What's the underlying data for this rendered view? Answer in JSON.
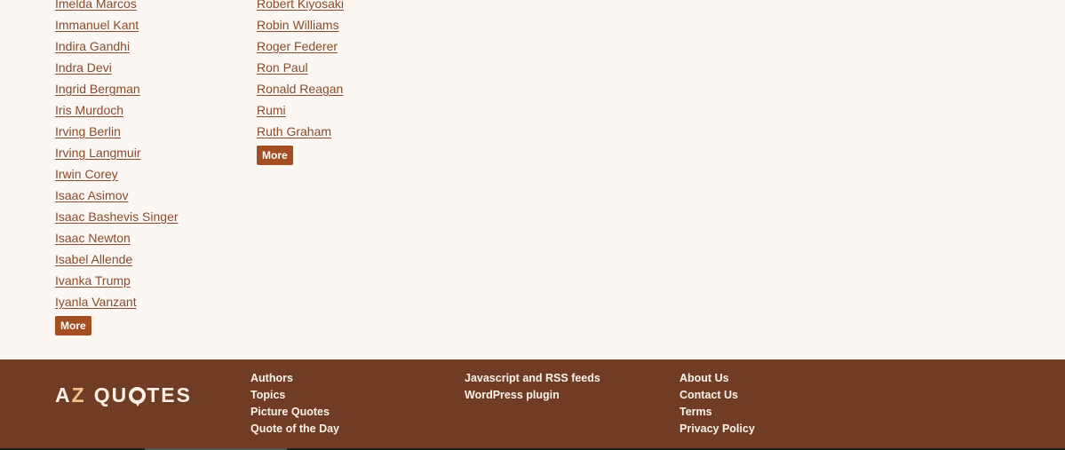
{
  "authors": {
    "column_a": [
      "Imelda Marcos",
      "Immanuel Kant",
      "Indira Gandhi",
      "Indra Devi",
      "Ingrid Bergman",
      "Iris Murdoch",
      "Irving Berlin",
      "Irving Langmuir",
      "Irwin Corey",
      "Isaac Asimov",
      "Isaac Bashevis Singer",
      "Isaac Newton",
      "Isabel Allende",
      "Ivanka Trump",
      "Iyanla Vanzant"
    ],
    "column_b": [
      "Robert Kiyosaki",
      "Robin Williams",
      "Roger Federer",
      "Ron Paul",
      "Ronald Reagan",
      "Rumi",
      "Ruth Graham"
    ],
    "more_label": "More"
  },
  "footer": {
    "logo": {
      "part1": "A",
      "part2": "Z",
      "part3": "QU",
      "part4": "TES"
    },
    "links_col1": [
      "Authors",
      "Topics",
      "Picture Quotes",
      "Quote of the Day"
    ],
    "links_col2": [
      "Javascript and RSS feeds",
      "WordPress plugin"
    ],
    "links_col3": [
      "About Us",
      "Contact Us",
      "Terms",
      "Privacy Policy"
    ]
  },
  "colors": {
    "background": "#fcf7f2",
    "link": "#8a4b2c",
    "button": "#a34f22",
    "footer": "#703d24",
    "footer_text": "#fbf2ea",
    "logo_accent": "#f4bf8a"
  }
}
